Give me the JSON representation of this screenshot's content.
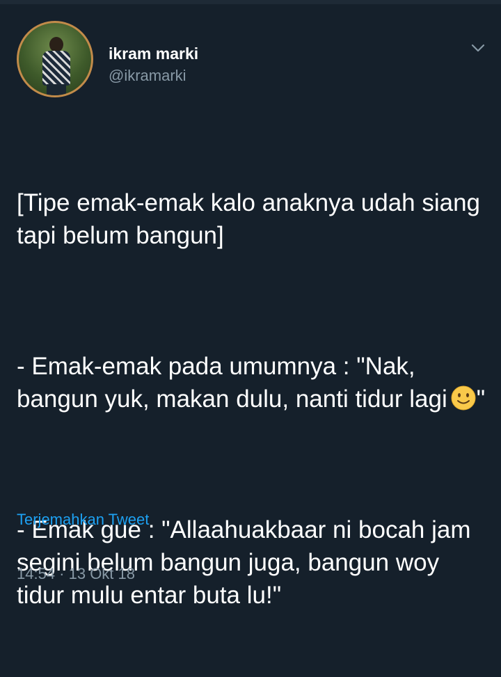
{
  "user": {
    "display_name": "ikram marki",
    "handle": "@ikramarki"
  },
  "tweet": {
    "para1": "[Tipe emak-emak kalo anaknya udah siang tapi belum bangun]",
    "para2_before_emoji": "- Emak-emak pada umumnya : \"Nak, bangun yuk, makan dulu, nanti tidur lagi",
    "emoji": "slightly-smiling-face-icon",
    "para2_after_emoji": "\"",
    "para3": "- Emak gue : \"Allaahuakbaar ni bocah jam segini belum bangun juga, bangun woy tidur mulu entar buta lu!\""
  },
  "translate_label": "Terjemahkan Tweet",
  "timestamp": "14:54 · 13 Okt 18",
  "colors": {
    "background": "#15202b",
    "text": "#ffffff",
    "secondary": "#8899a6",
    "link": "#1da1f2"
  }
}
